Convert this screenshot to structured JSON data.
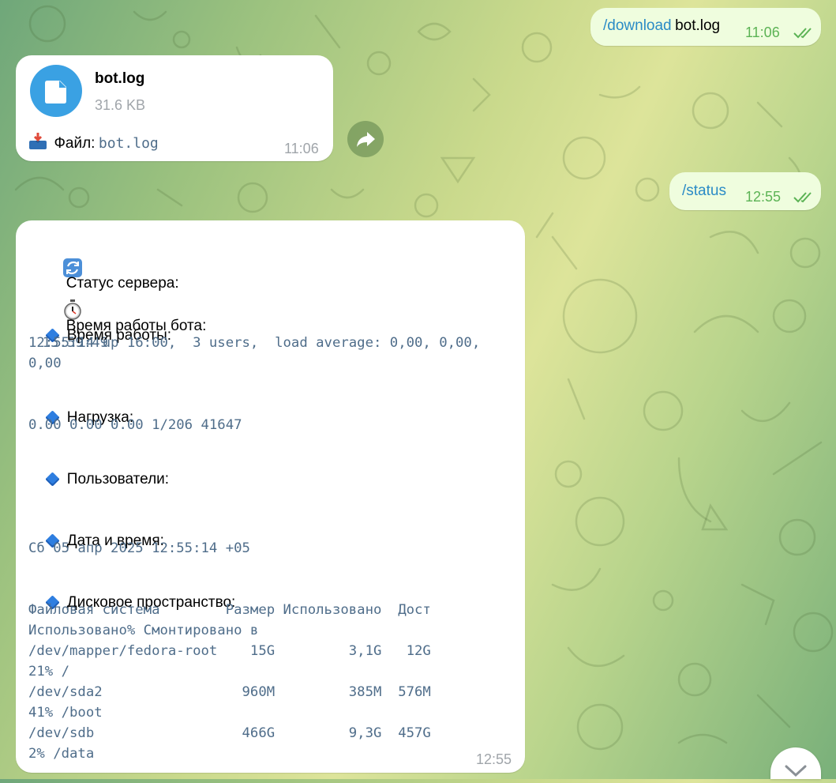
{
  "messages": {
    "download_cmd": {
      "command": "/download",
      "arg": "bot.log",
      "time": "11:06"
    },
    "file_msg": {
      "file_name": "bot.log",
      "file_size": "31.6 KB",
      "caption_label": "Файл:",
      "caption_file": "bot.log",
      "time": "11:06"
    },
    "status_cmd": {
      "command": "/status",
      "time": "12:55"
    },
    "status_reply": {
      "header": "Статус сервера:",
      "bot_uptime_label": "Время работы бота:",
      "bot_uptime_value": "15:59:49",
      "uptime_label": "Время работы:",
      "uptime_line1": "12:55:14 up 16:00,  3 users,  load average: 0,00, 0,00,",
      "uptime_line2": "0,00",
      "load_label": "Нагрузка:",
      "load_value": "0.00 0.00 0.00 1/206 41647",
      "users_label": "Пользователи:",
      "datetime_label": "Дата и время:",
      "datetime_value": "Сб 05 апр 2025 12:55:14 +05",
      "disk_label": "Дисковое пространство:",
      "disk_lines": [
        "Файловая система        Размер Использовано  Дост",
        "Использовано% Смонтировано в",
        "/dev/mapper/fedora-root    15G         3,1G   12G",
        "21% /",
        "/dev/sda2                 960M         385M  576M",
        "41% /boot",
        "/dev/sdb                  466G         9,3G  457G",
        "2% /data"
      ],
      "time": "12:55"
    }
  },
  "icons": {
    "file": "file-icon",
    "forward": "forward-icon",
    "scroll_down": "chevron-down-icon",
    "refresh": "refresh-emoji-icon",
    "stopwatch": "stopwatch-emoji-icon",
    "inbox": "inbox-tray-emoji-icon",
    "diamond": "blue-diamond-icon"
  },
  "colors": {
    "accent": "#2a8bc6",
    "outgoing_bubble": "#effdde",
    "incoming_bubble": "#ffffff",
    "mono_text": "#4f6d8a",
    "read_ticks": "#5cb355"
  }
}
